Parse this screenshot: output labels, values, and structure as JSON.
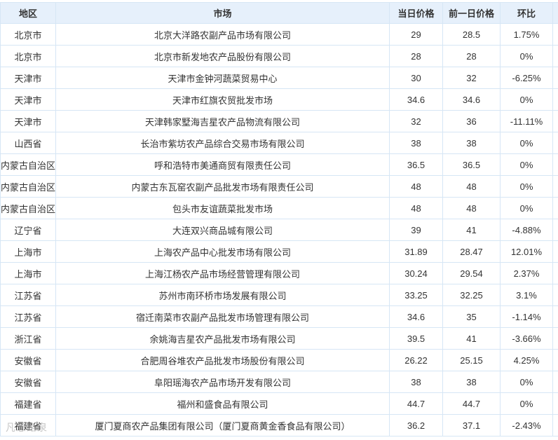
{
  "table": {
    "headers": {
      "region": "地区",
      "market": "市场",
      "today_price": "当日价格",
      "prev_price": "前一日价格",
      "change": "环比"
    },
    "rows": [
      {
        "region": "北京市",
        "market": "北京大洋路农副产品市场有限公司",
        "today": "29",
        "prev": "28.5",
        "change": "1.75%"
      },
      {
        "region": "北京市",
        "market": "北京市新发地农产品股份有限公司",
        "today": "28",
        "prev": "28",
        "change": "0%"
      },
      {
        "region": "天津市",
        "market": "天津市金钟河蔬菜贸易中心",
        "today": "30",
        "prev": "32",
        "change": "-6.25%"
      },
      {
        "region": "天津市",
        "market": "天津市红旗农贸批发市场",
        "today": "34.6",
        "prev": "34.6",
        "change": "0%"
      },
      {
        "region": "天津市",
        "market": "天津韩家墅海吉星农产品物流有限公司",
        "today": "32",
        "prev": "36",
        "change": "-11.11%"
      },
      {
        "region": "山西省",
        "market": "长治市紫坊农产品综合交易市场有限公司",
        "today": "38",
        "prev": "38",
        "change": "0%"
      },
      {
        "region": "内蒙古自治区",
        "market": "呼和浩特市美通商贸有限责任公司",
        "today": "36.5",
        "prev": "36.5",
        "change": "0%"
      },
      {
        "region": "内蒙古自治区",
        "market": "内蒙古东瓦窑农副产品批发市场有限责任公司",
        "today": "48",
        "prev": "48",
        "change": "0%"
      },
      {
        "region": "内蒙古自治区",
        "market": "包头市友谊蔬菜批发市场",
        "today": "48",
        "prev": "48",
        "change": "0%"
      },
      {
        "region": "辽宁省",
        "market": "大连双兴商品城有限公司",
        "today": "39",
        "prev": "41",
        "change": "-4.88%"
      },
      {
        "region": "上海市",
        "market": "上海农产品中心批发市场有限公司",
        "today": "31.89",
        "prev": "28.47",
        "change": "12.01%"
      },
      {
        "region": "上海市",
        "market": "上海江杨农产品市场经营管理有限公司",
        "today": "30.24",
        "prev": "29.54",
        "change": "2.37%"
      },
      {
        "region": "江苏省",
        "market": "苏州市南环桥市场发展有限公司",
        "today": "33.25",
        "prev": "32.25",
        "change": "3.1%"
      },
      {
        "region": "江苏省",
        "market": "宿迁南菜市农副产品批发市场管理有限公司",
        "today": "34.6",
        "prev": "35",
        "change": "-1.14%"
      },
      {
        "region": "浙江省",
        "market": "余姚海吉星农产品批发市场有限公司",
        "today": "39.5",
        "prev": "41",
        "change": "-3.66%"
      },
      {
        "region": "安徽省",
        "market": "合肥周谷堆农产品批发市场股份有限公司",
        "today": "26.22",
        "prev": "25.15",
        "change": "4.25%"
      },
      {
        "region": "安徽省",
        "market": "阜阳瑶海农产品市场开发有限公司",
        "today": "38",
        "prev": "38",
        "change": "0%"
      },
      {
        "region": "福建省",
        "market": "福州和盛食品有限公司",
        "today": "44.7",
        "prev": "44.7",
        "change": "0%"
      },
      {
        "region": "福建省",
        "market": "厦门夏商农产品集团有限公司（厦门夏商黄金香食品有限公司）",
        "today": "36.2",
        "prev": "37.1",
        "change": "-2.43%"
      }
    ]
  },
  "watermark": "凡思路泉",
  "colors": {
    "header_bg": "#e6f0fb",
    "border": "#d6e6f5",
    "text": "#333333"
  }
}
